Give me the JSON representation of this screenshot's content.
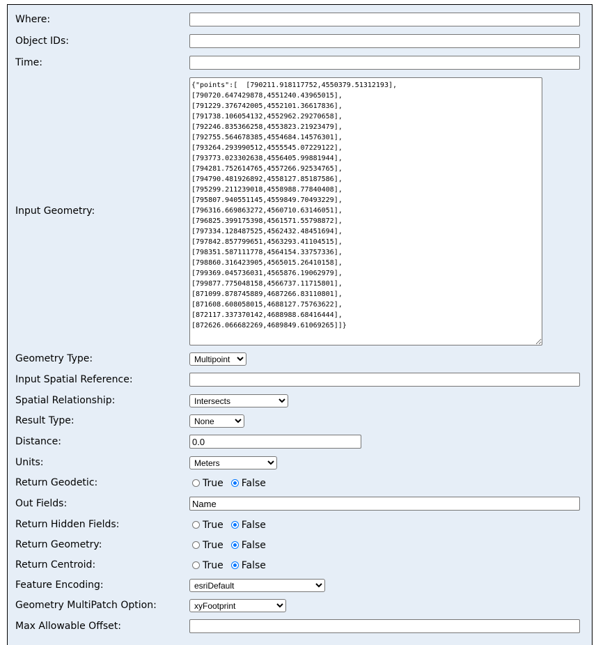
{
  "form": {
    "where": {
      "label": "Where:",
      "value": ""
    },
    "object_ids": {
      "label": "Object IDs:",
      "value": ""
    },
    "time": {
      "label": "Time:",
      "value": ""
    },
    "input_geometry": {
      "label": "Input Geometry:",
      "value": "{\"points\":[  [790211.918117752,4550379.51312193],\n[790720.647429878,4551240.43965015],\n[791229.376742005,4552101.36617836],\n[791738.106054132,4552962.29270658],\n[792246.835366258,4553823.21923479],\n[792755.564678385,4554684.14576301],\n[793264.293990512,4555545.07229122],\n[793773.023302638,4556405.99881944],\n[794281.752614765,4557266.92534765],\n[794790.481926892,4558127.85187586],\n[795299.211239018,4558988.77840408],\n[795807.940551145,4559849.70493229],\n[796316.669863272,4560710.63146051],\n[796825.399175398,4561571.55798872],\n[797334.128487525,4562432.48451694],\n[797842.857799651,4563293.41104515],\n[798351.587111778,4564154.33757336],\n[798860.316423905,4565015.26410158],\n[799369.045736031,4565876.19062979],\n[799877.775048158,4566737.11715801],\n[871099.878745889,4687266.83110801],\n[871608.608058015,4688127.75763622],\n[872117.337370142,4688988.68416444],\n[872626.066682269,4689849.61069265]]}"
    },
    "geometry_type": {
      "label": "Geometry Type:",
      "value": "Multipoint"
    },
    "input_spatial_reference": {
      "label": "Input Spatial Reference:",
      "value": ""
    },
    "spatial_relationship": {
      "label": "Spatial Relationship:",
      "value": "Intersects"
    },
    "result_type": {
      "label": "Result Type:",
      "value": "None"
    },
    "distance": {
      "label": "Distance:",
      "value": "0.0"
    },
    "units": {
      "label": "Units:",
      "value": "Meters"
    },
    "return_geodetic": {
      "label": "Return Geodetic:",
      "true_label": "True",
      "false_label": "False",
      "selected": "False"
    },
    "out_fields": {
      "label": "Out Fields:",
      "value": "Name"
    },
    "return_hidden_fields": {
      "label": "Return Hidden Fields:",
      "true_label": "True",
      "false_label": "False",
      "selected": "False"
    },
    "return_geometry": {
      "label": "Return Geometry:",
      "true_label": "True",
      "false_label": "False",
      "selected": "False"
    },
    "return_centroid": {
      "label": "Return Centroid:",
      "true_label": "True",
      "false_label": "False",
      "selected": "False"
    },
    "feature_encoding": {
      "label": "Feature Encoding:",
      "value": "esriDefault"
    },
    "geometry_multipatch_option": {
      "label": "Geometry MultiPatch Option:",
      "value": "xyFootprint"
    },
    "max_allowable_offset": {
      "label": "Max Allowable Offset:",
      "value": ""
    }
  }
}
